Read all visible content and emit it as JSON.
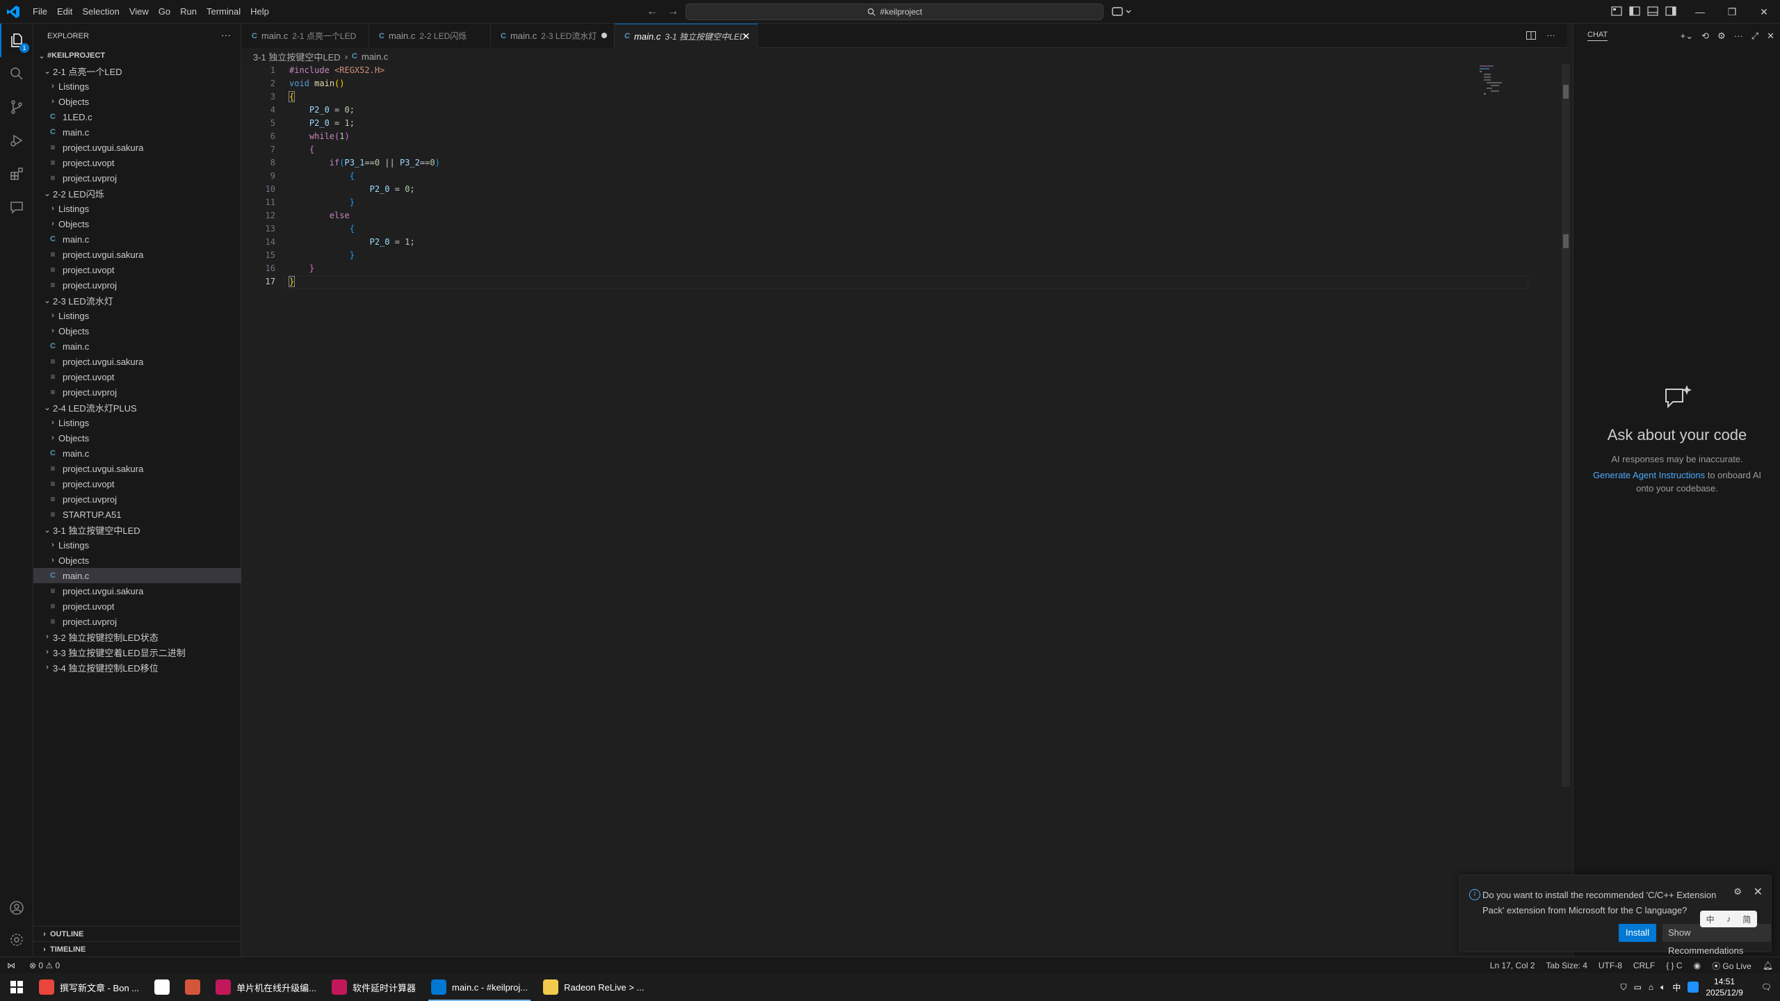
{
  "titlebar": {
    "menu": [
      "File",
      "Edit",
      "Selection",
      "View",
      "Go",
      "Run",
      "Terminal",
      "Help"
    ],
    "search_text": "#keilproject"
  },
  "activitybar": {
    "explorer_badge": "1"
  },
  "sidebar": {
    "title": "EXPLORER",
    "root": "#KEILPROJECT",
    "tree": [
      {
        "label": "2-1 点亮一个LED",
        "type": "folder-open",
        "depth": 1
      },
      {
        "label": "Listings",
        "type": "folder",
        "depth": 2
      },
      {
        "label": "Objects",
        "type": "folder",
        "depth": 2
      },
      {
        "label": "1LED.c",
        "type": "c",
        "depth": 2
      },
      {
        "label": "main.c",
        "type": "c",
        "depth": 2
      },
      {
        "label": "project.uvgui.sakura",
        "type": "txt",
        "depth": 2
      },
      {
        "label": "project.uvopt",
        "type": "txt",
        "depth": 2
      },
      {
        "label": "project.uvproj",
        "type": "txt",
        "depth": 2
      },
      {
        "label": "2-2 LED闪烁",
        "type": "folder-open",
        "depth": 1
      },
      {
        "label": "Listings",
        "type": "folder",
        "depth": 2
      },
      {
        "label": "Objects",
        "type": "folder",
        "depth": 2
      },
      {
        "label": "main.c",
        "type": "c",
        "depth": 2
      },
      {
        "label": "project.uvgui.sakura",
        "type": "txt",
        "depth": 2
      },
      {
        "label": "project.uvopt",
        "type": "txt",
        "depth": 2
      },
      {
        "label": "project.uvproj",
        "type": "txt",
        "depth": 2
      },
      {
        "label": "2-3 LED流水灯",
        "type": "folder-open",
        "depth": 1
      },
      {
        "label": "Listings",
        "type": "folder",
        "depth": 2
      },
      {
        "label": "Objects",
        "type": "folder",
        "depth": 2
      },
      {
        "label": "main.c",
        "type": "c",
        "depth": 2
      },
      {
        "label": "project.uvgui.sakura",
        "type": "txt",
        "depth": 2
      },
      {
        "label": "project.uvopt",
        "type": "txt",
        "depth": 2
      },
      {
        "label": "project.uvproj",
        "type": "txt",
        "depth": 2
      },
      {
        "label": "2-4 LED流水灯PLUS",
        "type": "folder-open",
        "depth": 1
      },
      {
        "label": "Listings",
        "type": "folder",
        "depth": 2
      },
      {
        "label": "Objects",
        "type": "folder",
        "depth": 2
      },
      {
        "label": "main.c",
        "type": "c",
        "depth": 2
      },
      {
        "label": "project.uvgui.sakura",
        "type": "txt",
        "depth": 2
      },
      {
        "label": "project.uvopt",
        "type": "txt",
        "depth": 2
      },
      {
        "label": "project.uvproj",
        "type": "txt",
        "depth": 2
      },
      {
        "label": "STARTUP.A51",
        "type": "txt",
        "depth": 2
      },
      {
        "label": "3-1 独立按键空中LED",
        "type": "folder-open",
        "depth": 1
      },
      {
        "label": "Listings",
        "type": "folder",
        "depth": 2
      },
      {
        "label": "Objects",
        "type": "folder",
        "depth": 2
      },
      {
        "label": "main.c",
        "type": "c",
        "depth": 2,
        "selected": true
      },
      {
        "label": "project.uvgui.sakura",
        "type": "txt",
        "depth": 2
      },
      {
        "label": "project.uvopt",
        "type": "txt",
        "depth": 2
      },
      {
        "label": "project.uvproj",
        "type": "txt",
        "depth": 2
      },
      {
        "label": "3-2 独立按键控制LED状态",
        "type": "folder",
        "depth": 1
      },
      {
        "label": "3-3 独立按键空着LED显示二进制",
        "type": "folder",
        "depth": 1
      },
      {
        "label": "3-4 独立按键控制LED移位",
        "type": "folder",
        "depth": 1
      }
    ],
    "outline": "OUTLINE",
    "timeline": "TIMELINE"
  },
  "tabs": [
    {
      "name": "main.c",
      "desc": "2-1 点亮一个LED"
    },
    {
      "name": "main.c",
      "desc": "2-2 LED闪烁"
    },
    {
      "name": "main.c",
      "desc": "2-3 LED流水灯"
    },
    {
      "name": "main.c",
      "desc": "3-1 独立按键空中LED"
    }
  ],
  "breadcrumb": {
    "folder": "3-1 独立按键空中LED",
    "file": "main.c"
  },
  "editor": {
    "lines": [
      "1",
      "2",
      "3",
      "4",
      "5",
      "6",
      "7",
      "8",
      "9",
      "10",
      "11",
      "12",
      "13",
      "14",
      "15",
      "16",
      "17"
    ]
  },
  "chat": {
    "title": "CHAT",
    "heading": "Ask about your code",
    "disclaimer": "AI responses may be inaccurate.",
    "link": "Generate Agent Instructions",
    "link_suffix": " to onboard AI onto your codebase."
  },
  "toast": {
    "message": "Do you want to install the recommended 'C/C++ Extension Pack' extension from Microsoft for the C language?",
    "install": "Install",
    "show": "Show Recommendations"
  },
  "ime": [
    "中",
    "♪",
    "简"
  ],
  "statusbar": {
    "errors": "0",
    "warnings": "0",
    "position": "Ln 17, Col 2",
    "tab_size": "Tab Size: 4",
    "encoding": "UTF-8",
    "eol": "CRLF",
    "language": "{ } C",
    "golive": "Go Live"
  },
  "taskbar": {
    "apps": [
      {
        "label": "撰写新文章 - Bon ...",
        "color": "#e8453c"
      },
      {
        "label": "",
        "color": "#ffffff"
      },
      {
        "label": "",
        "color": "#d4563a"
      },
      {
        "label": "单片机在线升级编...",
        "color": "#c2185b"
      },
      {
        "label": "软件延时计算器",
        "color": "#c2185b"
      },
      {
        "label": "main.c - #keilproj...",
        "color": "#0078d4"
      },
      {
        "label": "Radeon ReLive > ...",
        "color": "#f2c94c"
      }
    ],
    "ime": "中",
    "time": "14:51",
    "date": "2025/12/9"
  }
}
